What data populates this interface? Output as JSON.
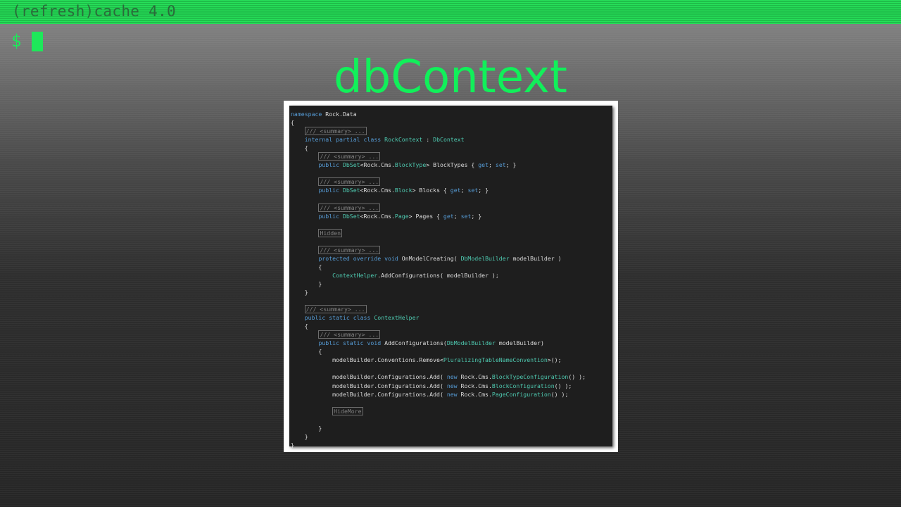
{
  "window": {
    "title": "(refresh)cache 4.0"
  },
  "terminal": {
    "prompt_symbol": "$"
  },
  "slide": {
    "heading": "dbContext"
  },
  "code": {
    "lines": [
      [
        {
          "t": "namespace",
          "c": "kw"
        },
        {
          "t": " Rock.Data"
        }
      ],
      [
        {
          "t": "{"
        }
      ],
      [
        {
          "t": "    "
        },
        {
          "t": "/// <summary> ...",
          "c": "cm"
        }
      ],
      [
        {
          "t": "    "
        },
        {
          "t": "internal",
          "c": "kw"
        },
        {
          "t": " "
        },
        {
          "t": "partial",
          "c": "kw"
        },
        {
          "t": " "
        },
        {
          "t": "class",
          "c": "kw"
        },
        {
          "t": " "
        },
        {
          "t": "RockContext",
          "c": "ty"
        },
        {
          "t": " : "
        },
        {
          "t": "DbContext",
          "c": "ty"
        }
      ],
      [
        {
          "t": "    {"
        }
      ],
      [
        {
          "t": "        "
        },
        {
          "t": "/// <summary> ...",
          "c": "cm"
        }
      ],
      [
        {
          "t": "        "
        },
        {
          "t": "public",
          "c": "kw"
        },
        {
          "t": " "
        },
        {
          "t": "DbSet",
          "c": "ty"
        },
        {
          "t": "<Rock.Cms."
        },
        {
          "t": "BlockType",
          "c": "ty"
        },
        {
          "t": "> BlockTypes { "
        },
        {
          "t": "get",
          "c": "kw"
        },
        {
          "t": "; "
        },
        {
          "t": "set",
          "c": "kw"
        },
        {
          "t": "; }"
        }
      ],
      [],
      [
        {
          "t": "        "
        },
        {
          "t": "/// <summary> ...",
          "c": "cm"
        }
      ],
      [
        {
          "t": "        "
        },
        {
          "t": "public",
          "c": "kw"
        },
        {
          "t": " "
        },
        {
          "t": "DbSet",
          "c": "ty"
        },
        {
          "t": "<Rock.Cms."
        },
        {
          "t": "Block",
          "c": "ty"
        },
        {
          "t": "> Blocks { "
        },
        {
          "t": "get",
          "c": "kw"
        },
        {
          "t": "; "
        },
        {
          "t": "set",
          "c": "kw"
        },
        {
          "t": "; }"
        }
      ],
      [],
      [
        {
          "t": "        "
        },
        {
          "t": "/// <summary> ...",
          "c": "cm"
        }
      ],
      [
        {
          "t": "        "
        },
        {
          "t": "public",
          "c": "kw"
        },
        {
          "t": " "
        },
        {
          "t": "DbSet",
          "c": "ty"
        },
        {
          "t": "<Rock.Cms."
        },
        {
          "t": "Page",
          "c": "ty"
        },
        {
          "t": "> Pages { "
        },
        {
          "t": "get",
          "c": "kw"
        },
        {
          "t": "; "
        },
        {
          "t": "set",
          "c": "kw"
        },
        {
          "t": "; }"
        }
      ],
      [],
      [
        {
          "t": "        "
        },
        {
          "t": "Hidden",
          "c": "cm"
        }
      ],
      [],
      [
        {
          "t": "        "
        },
        {
          "t": "/// <summary> ...",
          "c": "cm"
        }
      ],
      [
        {
          "t": "        "
        },
        {
          "t": "protected",
          "c": "kw"
        },
        {
          "t": " "
        },
        {
          "t": "override",
          "c": "kw"
        },
        {
          "t": " "
        },
        {
          "t": "void",
          "c": "kw"
        },
        {
          "t": " OnModelCreating( "
        },
        {
          "t": "DbModelBuilder",
          "c": "ty"
        },
        {
          "t": " modelBuilder )"
        }
      ],
      [
        {
          "t": "        {"
        }
      ],
      [
        {
          "t": "            "
        },
        {
          "t": "ContextHelper",
          "c": "ty"
        },
        {
          "t": ".AddConfigurations( modelBuilder );"
        }
      ],
      [
        {
          "t": "        }"
        }
      ],
      [
        {
          "t": "    }"
        }
      ],
      [],
      [
        {
          "t": "    "
        },
        {
          "t": "/// <summary> ...",
          "c": "cm"
        }
      ],
      [
        {
          "t": "    "
        },
        {
          "t": "public",
          "c": "kw"
        },
        {
          "t": " "
        },
        {
          "t": "static",
          "c": "kw"
        },
        {
          "t": " "
        },
        {
          "t": "class",
          "c": "kw"
        },
        {
          "t": " "
        },
        {
          "t": "ContextHelper",
          "c": "ty"
        }
      ],
      [
        {
          "t": "    {"
        }
      ],
      [
        {
          "t": "        "
        },
        {
          "t": "/// <summary> ...",
          "c": "cm"
        }
      ],
      [
        {
          "t": "        "
        },
        {
          "t": "public",
          "c": "kw"
        },
        {
          "t": " "
        },
        {
          "t": "static",
          "c": "kw"
        },
        {
          "t": " "
        },
        {
          "t": "void",
          "c": "kw"
        },
        {
          "t": " AddConfigurations("
        },
        {
          "t": "DbModelBuilder",
          "c": "ty"
        },
        {
          "t": " modelBuilder)"
        }
      ],
      [
        {
          "t": "        {"
        }
      ],
      [
        {
          "t": "            modelBuilder.Conventions.Remove<"
        },
        {
          "t": "PluralizingTableNameConvention",
          "c": "ty"
        },
        {
          "t": ">();"
        }
      ],
      [],
      [
        {
          "t": "            modelBuilder.Configurations.Add( "
        },
        {
          "t": "new",
          "c": "kw"
        },
        {
          "t": " Rock.Cms."
        },
        {
          "t": "BlockTypeConfiguration",
          "c": "ty"
        },
        {
          "t": "() );"
        }
      ],
      [
        {
          "t": "            modelBuilder.Configurations.Add( "
        },
        {
          "t": "new",
          "c": "kw"
        },
        {
          "t": " Rock.Cms."
        },
        {
          "t": "BlockConfiguration",
          "c": "ty"
        },
        {
          "t": "() );"
        }
      ],
      [
        {
          "t": "            modelBuilder.Configurations.Add( "
        },
        {
          "t": "new",
          "c": "kw"
        },
        {
          "t": " Rock.Cms."
        },
        {
          "t": "PageConfiguration",
          "c": "ty"
        },
        {
          "t": "() );"
        }
      ],
      [],
      [
        {
          "t": "            "
        },
        {
          "t": "HideMore",
          "c": "cm"
        }
      ],
      [],
      [
        {
          "t": "        }"
        }
      ],
      [
        {
          "t": "    }"
        }
      ],
      [
        {
          "t": "}"
        }
      ]
    ]
  }
}
